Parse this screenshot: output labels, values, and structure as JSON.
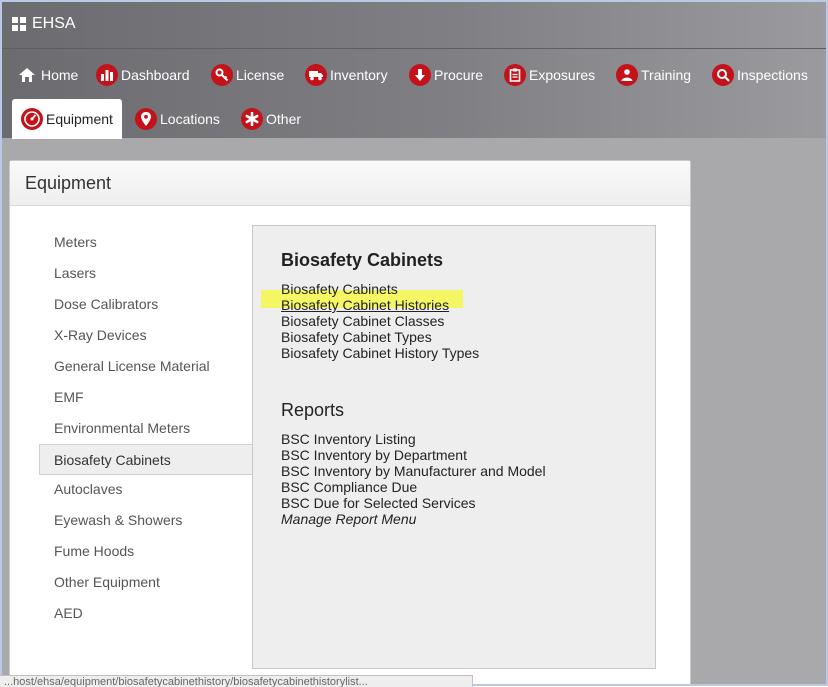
{
  "app": {
    "title": "EHSA"
  },
  "nav": {
    "items": [
      {
        "label": "Home",
        "icon": "home-icon"
      },
      {
        "label": "Dashboard",
        "icon": "bar-chart-icon"
      },
      {
        "label": "License",
        "icon": "key-icon"
      },
      {
        "label": "Inventory",
        "icon": "truck-icon"
      },
      {
        "label": "Procure",
        "icon": "arrow-down-icon"
      },
      {
        "label": "Exposures",
        "icon": "clipboard-icon"
      },
      {
        "label": "Training",
        "icon": "person-icon"
      },
      {
        "label": "Inspections",
        "icon": "magnifier-icon"
      },
      {
        "label": "Equipment",
        "icon": "gauge-icon",
        "active": true
      },
      {
        "label": "Locations",
        "icon": "map-pin-icon"
      },
      {
        "label": "Other",
        "icon": "asterisk-icon"
      }
    ]
  },
  "panel": {
    "title": "Equipment"
  },
  "sidebar": {
    "items": [
      {
        "label": "Meters"
      },
      {
        "label": "Lasers"
      },
      {
        "label": "Dose Calibrators"
      },
      {
        "label": "X-Ray Devices"
      },
      {
        "label": "General License Material"
      },
      {
        "label": "EMF"
      },
      {
        "label": "Environmental Meters"
      },
      {
        "label": "Biosafety Cabinets",
        "selected": true
      },
      {
        "label": "Autoclaves"
      },
      {
        "label": "Eyewash & Showers"
      },
      {
        "label": "Fume Hoods"
      },
      {
        "label": "Other Equipment"
      },
      {
        "label": "AED"
      }
    ]
  },
  "content": {
    "section1": {
      "title": "Biosafety Cabinets",
      "links": [
        "Biosafety Cabinets",
        "Biosafety Cabinet Histories",
        "Biosafety Cabinet Classes",
        "Biosafety Cabinet Types",
        "Biosafety Cabinet History Types"
      ]
    },
    "section2": {
      "title": "Reports",
      "links": [
        "BSC Inventory Listing",
        "BSC Inventory by Department",
        "BSC Inventory by Manufacturer and Model",
        "BSC Compliance Due",
        "BSC Due for Selected Services"
      ],
      "manage": "Manage Report Menu"
    }
  },
  "status": {
    "url": "...host/ehsa/equipment/biosafetycabinethistory/biosafetycabinethistorylist..."
  },
  "colors": {
    "accent": "#c4121a",
    "highlight": "#f4f74a"
  }
}
